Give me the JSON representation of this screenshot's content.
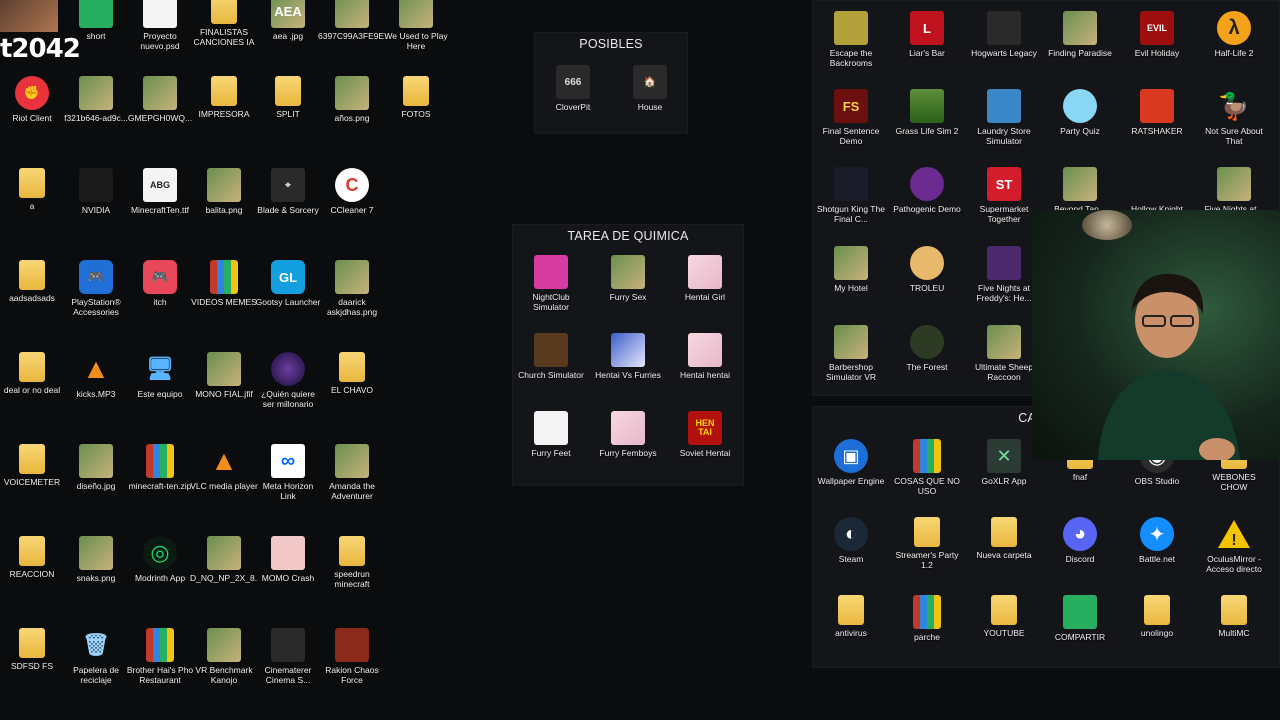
{
  "overlay": {
    "streamer_text": "t2042"
  },
  "left_icons": [
    {
      "label": "short",
      "glyph": "",
      "kind": "green"
    },
    {
      "label": "Proyecto nuevo.psd",
      "glyph": "",
      "kind": "white"
    },
    {
      "label": "FINALISTAS CANCIONES IA",
      "glyph": "",
      "kind": "folder"
    },
    {
      "label": "aea .jpg",
      "glyph": "AEA",
      "kind": "img"
    },
    {
      "label": "6397C99A3FE9E...",
      "glyph": "",
      "kind": "img"
    },
    {
      "label": "We Used to Play Here",
      "glyph": "",
      "kind": "img"
    },
    {
      "label": "Riot Client",
      "glyph": "✊",
      "kind": "riot"
    },
    {
      "label": "f321b646-ad9c...",
      "glyph": "",
      "kind": "img"
    },
    {
      "label": "GMEPGH0WQ...",
      "glyph": "",
      "kind": "img"
    },
    {
      "label": "IMPRESORA",
      "glyph": "",
      "kind": "folder"
    },
    {
      "label": "SPLIT",
      "glyph": "",
      "kind": "folder"
    },
    {
      "label": "años.png",
      "glyph": "",
      "kind": "img"
    },
    {
      "label": "FOTOS",
      "glyph": "",
      "kind": "folder"
    },
    {
      "label": "a",
      "glyph": "",
      "kind": "folder"
    },
    {
      "label": "NVIDIA",
      "glyph": "",
      "kind": "nvidia"
    },
    {
      "label": "MinecraftTen.ttf",
      "glyph": "ABG",
      "kind": "white"
    },
    {
      "label": "balita.png",
      "glyph": "",
      "kind": "img"
    },
    {
      "label": "Blade & Sorcery",
      "glyph": "⌖",
      "kind": "dark"
    },
    {
      "label": "CCleaner 7",
      "glyph": "C",
      "kind": "ccleaner"
    },
    {
      "label": "aadsadsads",
      "glyph": "",
      "kind": "folder"
    },
    {
      "label": "PlayStation® Accessories",
      "glyph": "🎮",
      "kind": "ps"
    },
    {
      "label": "itch",
      "glyph": "🎮",
      "kind": "itch"
    },
    {
      "label": "VIDEOS MEMES",
      "glyph": "",
      "kind": "rar"
    },
    {
      "label": "Gootsy Launcher",
      "glyph": "GL",
      "kind": "gl"
    },
    {
      "label": "daarick askjdhas.png",
      "glyph": "",
      "kind": "img"
    },
    {
      "label": "deal or no deal",
      "glyph": "",
      "kind": "folder"
    },
    {
      "label": "kicks.MP3",
      "glyph": "▲",
      "kind": "vlc"
    },
    {
      "label": "Este equipo",
      "glyph": "🖥",
      "kind": "pc"
    },
    {
      "label": "MONO FIAL.jfif",
      "glyph": "",
      "kind": "img"
    },
    {
      "label": "¿Quién quiere ser millonario",
      "glyph": "",
      "kind": "qqsm"
    },
    {
      "label": "EL CHAVO",
      "glyph": "",
      "kind": "folder"
    },
    {
      "label": "VOICEMETER",
      "glyph": "",
      "kind": "folder"
    },
    {
      "label": "diseño.jpg",
      "glyph": "",
      "kind": "img"
    },
    {
      "label": "minecraft-ten.zip",
      "glyph": "",
      "kind": "rar"
    },
    {
      "label": "VLC media player",
      "glyph": "▲",
      "kind": "vlc"
    },
    {
      "label": "Meta Horizon Link",
      "glyph": "∞",
      "kind": "meta"
    },
    {
      "label": "Amanda the Adventurer",
      "glyph": "",
      "kind": "img"
    },
    {
      "label": "REACCION",
      "glyph": "",
      "kind": "folder"
    },
    {
      "label": "snaks.png",
      "glyph": "",
      "kind": "img"
    },
    {
      "label": "Modrinth App",
      "glyph": "◎",
      "kind": "modrinth"
    },
    {
      "label": "D_NQ_NP_2X_8...",
      "glyph": "",
      "kind": "img"
    },
    {
      "label": "MOMO Crash",
      "glyph": "",
      "kind": "momo"
    },
    {
      "label": "speedrun minecraft",
      "glyph": "",
      "kind": "folder"
    },
    {
      "label": "SDFSD FS",
      "glyph": "",
      "kind": "folder"
    },
    {
      "label": "Papelera de reciclaje",
      "glyph": "🗑",
      "kind": "bin"
    },
    {
      "label": "Brother Hai's Pho Restaurant",
      "glyph": "",
      "kind": "rar"
    },
    {
      "label": "VR Benchmark Kanojo",
      "glyph": "",
      "kind": "img"
    },
    {
      "label": "Cinematerer Cinema S...",
      "glyph": "",
      "kind": "dark"
    },
    {
      "label": "Rakion Chaos Force",
      "glyph": "",
      "kind": "rakion"
    }
  ],
  "fence_posibles": {
    "title": "POSIBLES",
    "items": [
      {
        "label": "CloverPit",
        "glyph": "666",
        "kind": "dark"
      },
      {
        "label": "House",
        "glyph": "🏠",
        "kind": "dark"
      }
    ]
  },
  "fence_tarea": {
    "title": "TAREA DE QUIMICA",
    "items": [
      {
        "label": "NightClub Simulator",
        "glyph": "",
        "kind": "pink"
      },
      {
        "label": "Furry Sex",
        "glyph": "",
        "kind": "img"
      },
      {
        "label": "Hentai Girl",
        "glyph": "",
        "kind": "anime"
      },
      {
        "label": "Church Simulator",
        "glyph": "",
        "kind": "church"
      },
      {
        "label": "Hentai Vs Furries",
        "glyph": "",
        "kind": "anime2"
      },
      {
        "label": "Hentai hentai",
        "glyph": "",
        "kind": "anime"
      },
      {
        "label": "Furry Feet",
        "glyph": "",
        "kind": "white"
      },
      {
        "label": "Furry Femboys",
        "glyph": "",
        "kind": "anime"
      },
      {
        "label": "Soviet Hentai",
        "glyph": "HEN TAI",
        "kind": "soviet"
      }
    ]
  },
  "fence_games": {
    "items": [
      {
        "label": "Escape the Backrooms",
        "glyph": "",
        "kind": "backrooms"
      },
      {
        "label": "Liar's Bar",
        "glyph": "L",
        "kind": "liars"
      },
      {
        "label": "Hogwarts Legacy",
        "glyph": "",
        "kind": "dark"
      },
      {
        "label": "Finding Paradise",
        "glyph": "",
        "kind": "img"
      },
      {
        "label": "Evil Holiday",
        "glyph": "EVIL",
        "kind": "evil"
      },
      {
        "label": "Half-Life 2",
        "glyph": "λ",
        "kind": "hl2"
      },
      {
        "label": "Final Sentence Demo",
        "glyph": "FS",
        "kind": "fs"
      },
      {
        "label": "Grass Life Sim 2",
        "glyph": "",
        "kind": "grass"
      },
      {
        "label": "Laundry Store Simulator",
        "glyph": "",
        "kind": "laundry"
      },
      {
        "label": "Party Quiz",
        "glyph": "",
        "kind": "quiz"
      },
      {
        "label": "RATSHAKER",
        "glyph": "",
        "kind": "rat"
      },
      {
        "label": "Not Sure About That",
        "glyph": "🦆",
        "kind": "duck"
      },
      {
        "label": "Shotgun King The Final C...",
        "glyph": "",
        "kind": "shotgun"
      },
      {
        "label": "Pathogenic Demo",
        "glyph": "",
        "kind": "patho"
      },
      {
        "label": "Supermarket Together",
        "glyph": "ST",
        "kind": "super"
      },
      {
        "label": "Beyond Tap...",
        "glyph": "",
        "kind": "img"
      },
      {
        "label": "Hollow Knight",
        "glyph": "",
        "kind": "hollow"
      },
      {
        "label": "Five Nights at...",
        "glyph": "",
        "kind": "img"
      },
      {
        "label": "My Hotel",
        "glyph": "",
        "kind": "img"
      },
      {
        "label": "TROLEU",
        "glyph": "",
        "kind": "troleu"
      },
      {
        "label": "Five Nights at Freddy's: He...",
        "glyph": "",
        "kind": "fnaf"
      },
      {
        "label": "Barbershop Simulator VR",
        "glyph": "",
        "kind": "img"
      },
      {
        "label": "The Forest",
        "glyph": "",
        "kind": "forest"
      },
      {
        "label": "Ultimate Sheep Raccoon",
        "glyph": "",
        "kind": "img"
      }
    ]
  },
  "fence_apps": {
    "title": "CAF",
    "items": [
      {
        "label": "Wallpaper Engine",
        "glyph": "▣",
        "kind": "wallpaper"
      },
      {
        "label": "COSAS QUE NO USO",
        "glyph": "",
        "kind": "rar"
      },
      {
        "label": "GoXLR App",
        "glyph": "✕",
        "kind": "goxlr"
      },
      {
        "label": "fnaf",
        "glyph": "",
        "kind": "folder"
      },
      {
        "label": "OBS Studio",
        "glyph": "◉",
        "kind": "obs"
      },
      {
        "label": "WEBONES CHOW",
        "glyph": "",
        "kind": "folder"
      },
      {
        "label": "Steam",
        "glyph": "◐",
        "kind": "steam"
      },
      {
        "label": "Streamer's Party 1.2",
        "glyph": "",
        "kind": "folder"
      },
      {
        "label": "Nueva carpeta",
        "glyph": "",
        "kind": "folder"
      },
      {
        "label": "Discord",
        "glyph": "◕",
        "kind": "discord"
      },
      {
        "label": "Battle.net",
        "glyph": "✦",
        "kind": "battlenet"
      },
      {
        "label": "OculusMirror - Acceso directo",
        "glyph": "!",
        "kind": "warn"
      },
      {
        "label": "antivirus",
        "glyph": "",
        "kind": "folder"
      },
      {
        "label": "parche",
        "glyph": "",
        "kind": "rar"
      },
      {
        "label": "YOUTUBE",
        "glyph": "",
        "kind": "folder"
      },
      {
        "label": "COMPARTIR",
        "glyph": "",
        "kind": "green"
      },
      {
        "label": "unolingo",
        "glyph": "",
        "kind": "folder"
      },
      {
        "label": "MultiMC",
        "glyph": "",
        "kind": "folder"
      }
    ]
  },
  "colors": {
    "desktop_bg": "#0b0c0e",
    "fence_bg": "#141518",
    "folder": "#f2c94c"
  }
}
